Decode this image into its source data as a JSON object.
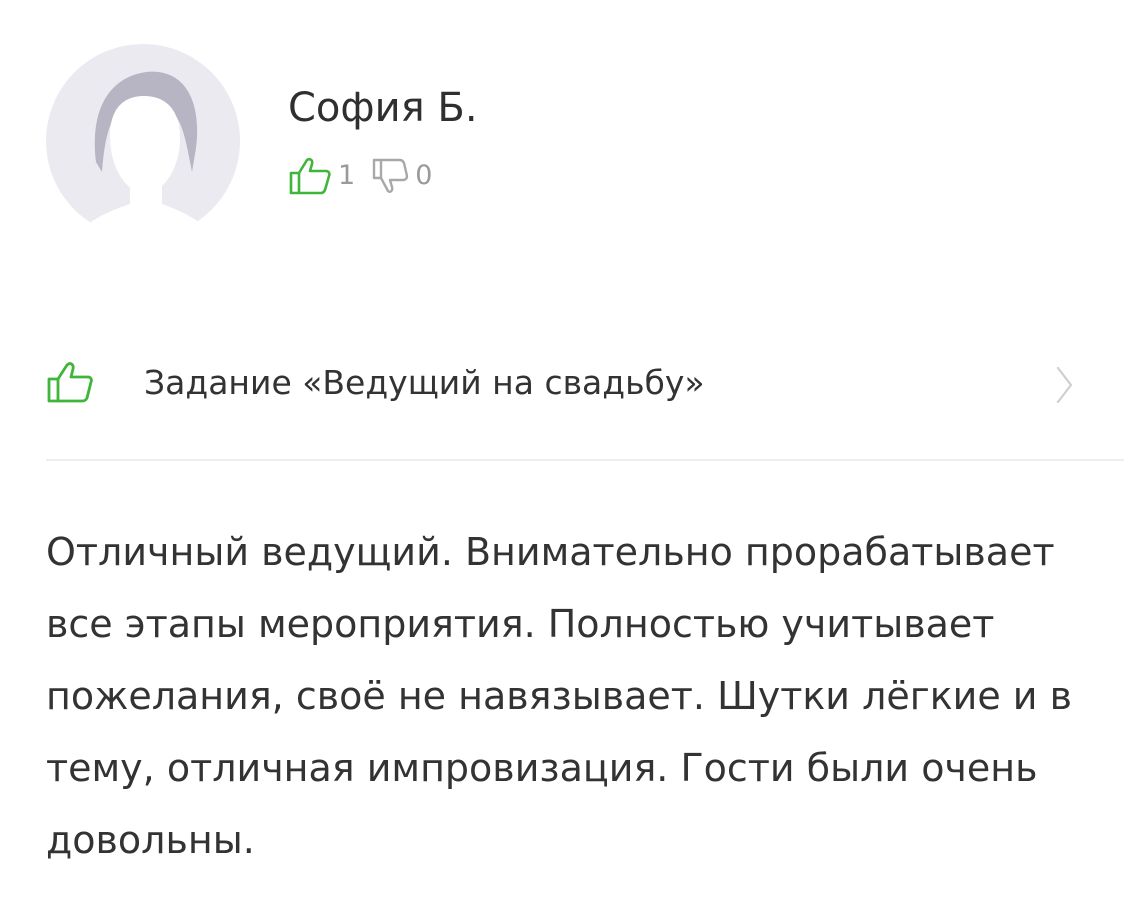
{
  "author": {
    "name": "София Б."
  },
  "votes": {
    "likes": "1",
    "dislikes": "0"
  },
  "task": {
    "label": "Задание «Ведущий на свадьбу»"
  },
  "review": {
    "text": "Отличный ведущий. Внимательно прорабатывает все этапы мероприятия. Полностью учитывает пожелания, своё не навязывает. Шутки лёгкие и в тему, отличная импровизация. Гости были очень довольны."
  },
  "icons": {
    "like": "thumbs-up-icon",
    "dislike": "thumbs-down-icon",
    "avatar": "user-silhouette-icon",
    "chevron": "chevron-right-icon"
  },
  "colors": {
    "like": "#3fb53a",
    "muted": "#9a9a9a",
    "text": "#333333",
    "avatar_bg": "#ebeaf0",
    "hair": "#b7b4c3"
  }
}
